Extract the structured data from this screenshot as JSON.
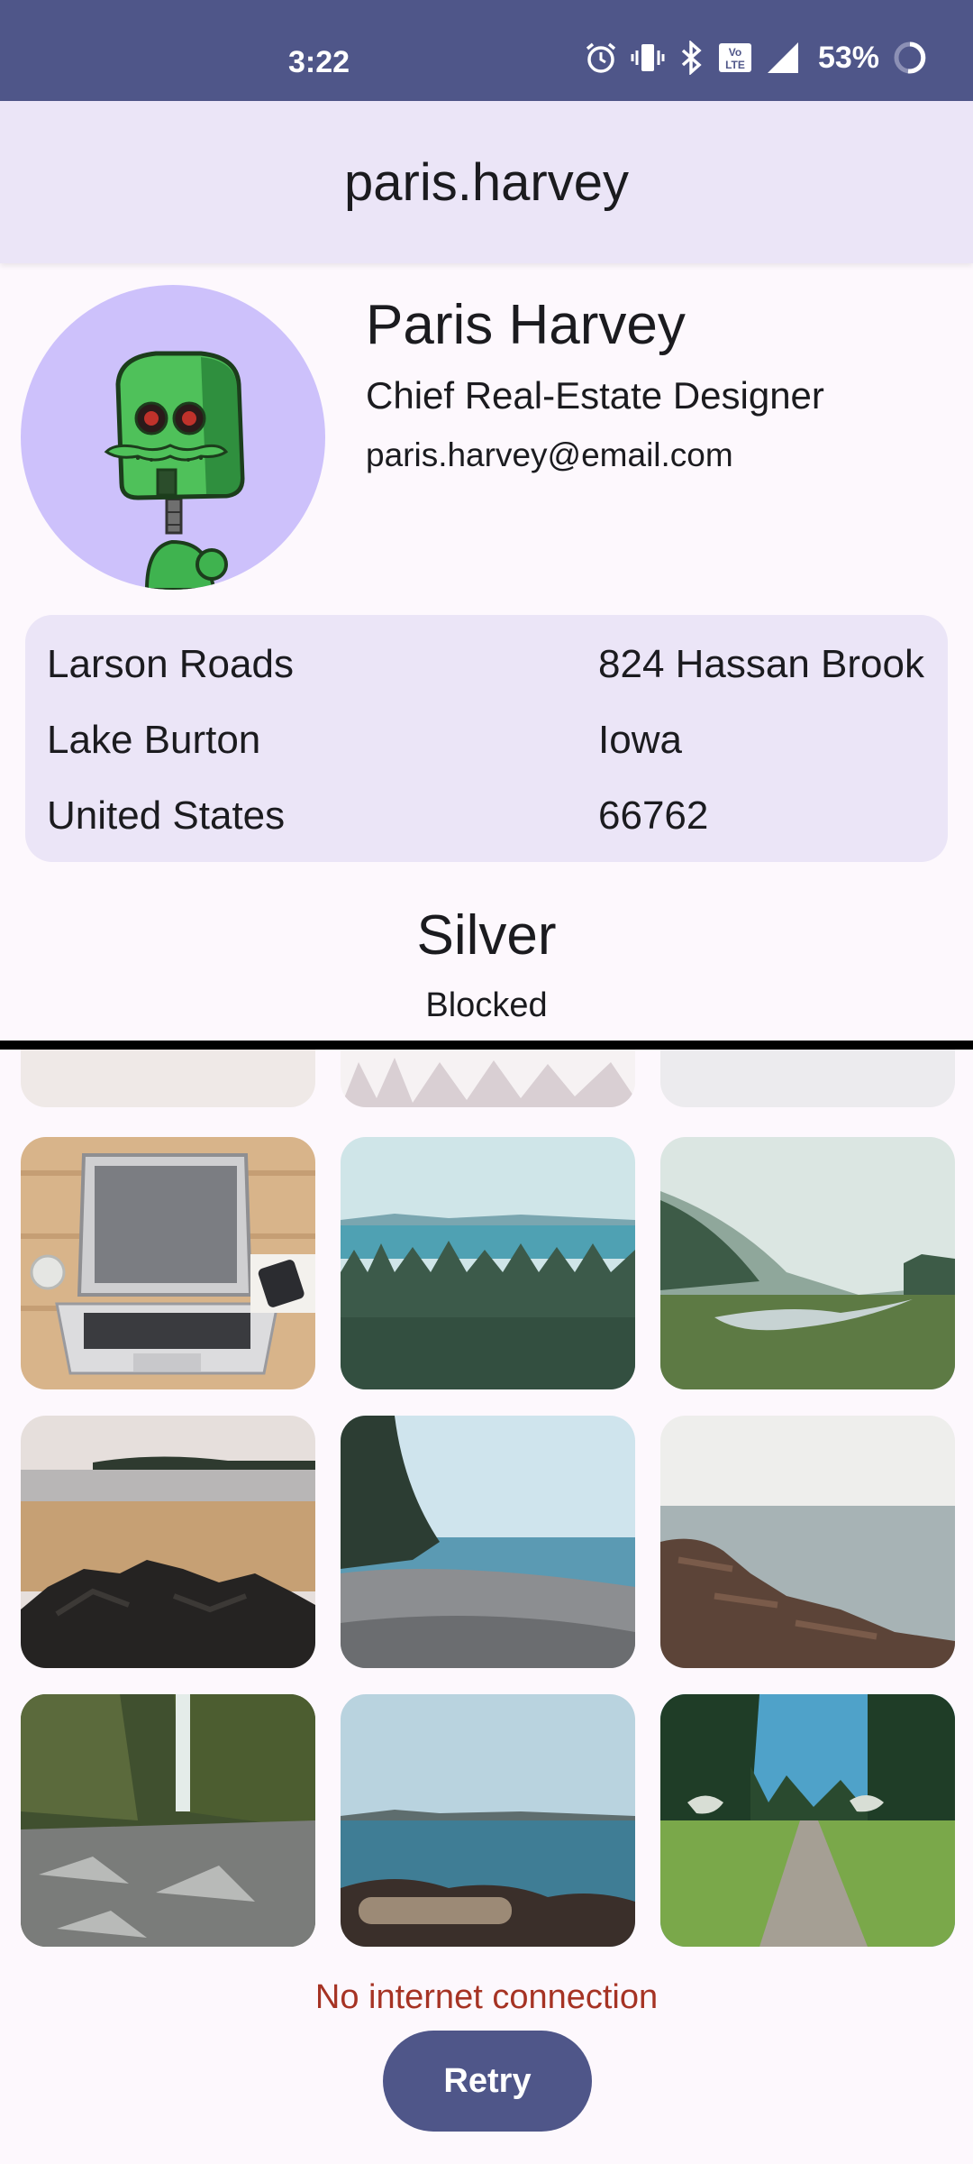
{
  "status_bar": {
    "time": "3:22",
    "battery": "53%",
    "icons": [
      "alarm-icon",
      "vibrate-icon",
      "bluetooth-icon",
      "volte-icon",
      "signal-icon",
      "battery-icon"
    ]
  },
  "app_bar": {
    "title": "paris.harvey"
  },
  "profile": {
    "name": "Paris Harvey",
    "job_title": "Chief Real-Estate Designer",
    "email": "paris.harvey@email.com",
    "avatar": "robot-avatar"
  },
  "address": {
    "street": "Larson Roads",
    "building": "824 Hassan Brook",
    "city": "Lake Burton",
    "state": "Iowa",
    "country": "United States",
    "zip": "66762"
  },
  "membership": {
    "tier": "Silver",
    "status": "Blocked"
  },
  "gallery": {
    "images": [
      "laptop-desk",
      "forest-sea",
      "misty-river",
      "sandy-beach-rocks",
      "pebble-shore",
      "rocky-coast",
      "waterfall",
      "sea-driftwood",
      "forest-path"
    ]
  },
  "footer": {
    "error": "No internet connection",
    "retry_label": "Retry"
  },
  "colors": {
    "primary": "#4f5689",
    "surface_variant": "#ebe5f7",
    "avatar_bg": "#cdc1fb",
    "error": "#a63324"
  }
}
